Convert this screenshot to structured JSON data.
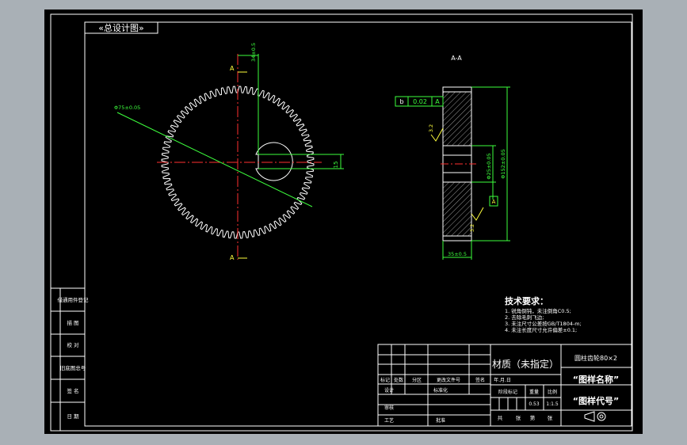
{
  "drawing": {
    "stamp_label": "«总设计图»",
    "main_view": {
      "dim_top": "34±0.5",
      "dim_right": "15",
      "dim_leader": "Φ75±0.05",
      "section_marker_top": "A",
      "section_marker_bottom": "A"
    },
    "section_view": {
      "title": "A-A",
      "runout_symbol": "b",
      "runout_value": "0.02",
      "runout_datum": "A",
      "roughness_top": "3.2",
      "roughness_bottom": "3.2",
      "dim_bore": "Φ25±0.05",
      "dim_outer": "Φ152±0.05",
      "dim_width": "35±0.5",
      "datum_tag": "A"
    },
    "tech_requirements": {
      "heading": "技术要求：",
      "items": [
        "1. 锐角倒钝，未注倒角C0.5;",
        "2. 去除毛刺飞边;",
        "3. 未注尺寸公差按GB/T1804-m;",
        "4. 未注长度尺寸允许偏差±0.1;"
      ]
    },
    "left_strip": {
      "labels": [
        "借通用件登记",
        "描 图",
        "校 对",
        "旧底图总号",
        "签 名",
        "日 期"
      ]
    },
    "title_block": {
      "material": "材质（未指定）",
      "part_spec": "圆柱齿轮80×2",
      "drawing_name": "“图样名称”",
      "drawing_code": "“图样代号”",
      "change_row": [
        "标记",
        "处数",
        "分区",
        "更改文件号",
        "签名",
        "年.月.日"
      ],
      "designer_row": [
        "设计",
        "",
        "标准化"
      ],
      "review_row": [
        "审核",
        ""
      ],
      "process_row": [
        "工艺",
        "",
        "批准"
      ],
      "stage_header": [
        "阶段标记",
        "重量",
        "比例"
      ],
      "weight": "0.53",
      "scale": "1:1.5",
      "sheet_row": [
        "共",
        "张",
        "第",
        "张"
      ]
    }
  }
}
